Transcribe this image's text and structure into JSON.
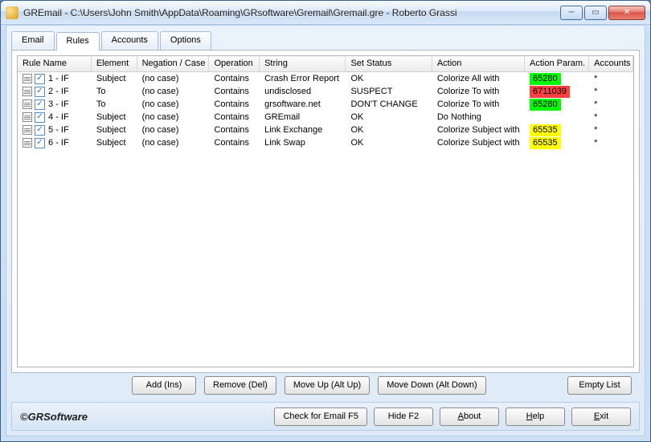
{
  "title": "GREmail - C:\\Users\\John Smith\\AppData\\Roaming\\GRsoftware\\Gremail\\Gremail.gre - Roberto Grassi",
  "tabs": {
    "email": "Email",
    "rules": "Rules",
    "accounts": "Accounts",
    "options": "Options"
  },
  "columns": {
    "rule_name": "Rule Name",
    "element": "Element",
    "negation": "Negation / Case",
    "operation": "Operation",
    "string": "String",
    "set_status": "Set Status",
    "action": "Action",
    "action_param": "Action Param.",
    "accounts": "Accounts"
  },
  "rows": [
    {
      "name": "1 - IF",
      "element": "Subject",
      "neg": "(no case)",
      "op": "Contains",
      "string": "Crash Error Report",
      "status": "OK",
      "action": "Colorize All with",
      "param": "65280",
      "pcolor": "green",
      "acc": "*"
    },
    {
      "name": "2 - IF",
      "element": "To",
      "neg": "(no case)",
      "op": "Contains",
      "string": "undisclosed",
      "status": "SUSPECT",
      "action": "Colorize To with",
      "param": "6711039",
      "pcolor": "red",
      "acc": "*"
    },
    {
      "name": "3 - IF",
      "element": "To",
      "neg": "(no case)",
      "op": "Contains",
      "string": "grsoftware.net",
      "status": "DON'T CHANGE",
      "action": "Colorize To with",
      "param": "65280",
      "pcolor": "green",
      "acc": "*"
    },
    {
      "name": "4 - IF",
      "element": "Subject",
      "neg": "(no case)",
      "op": "Contains",
      "string": "GREmail",
      "status": "OK",
      "action": "Do Nothing",
      "param": "",
      "pcolor": "",
      "acc": "*"
    },
    {
      "name": "5 - IF",
      "element": "Subject",
      "neg": "(no case)",
      "op": "Contains",
      "string": "Link Exchange",
      "status": "OK",
      "action": "Colorize Subject with",
      "param": "65535",
      "pcolor": "yellow",
      "acc": "*"
    },
    {
      "name": "6 - IF",
      "element": "Subject",
      "neg": "(no case)",
      "op": "Contains",
      "string": "Link Swap",
      "status": "OK",
      "action": "Colorize Subject with",
      "param": "65535",
      "pcolor": "yellow",
      "acc": "*"
    }
  ],
  "buttons": {
    "add": "Add (Ins)",
    "remove": "Remove (Del)",
    "moveup": "Move Up (Alt Up)",
    "movedown": "Move Down (Alt Down)",
    "empty": "Empty List",
    "check": "Check for Email F5",
    "hide": "Hide F2",
    "about": "About",
    "help": "Help",
    "exit": "Exit"
  },
  "copyright": "©GRSoftware"
}
